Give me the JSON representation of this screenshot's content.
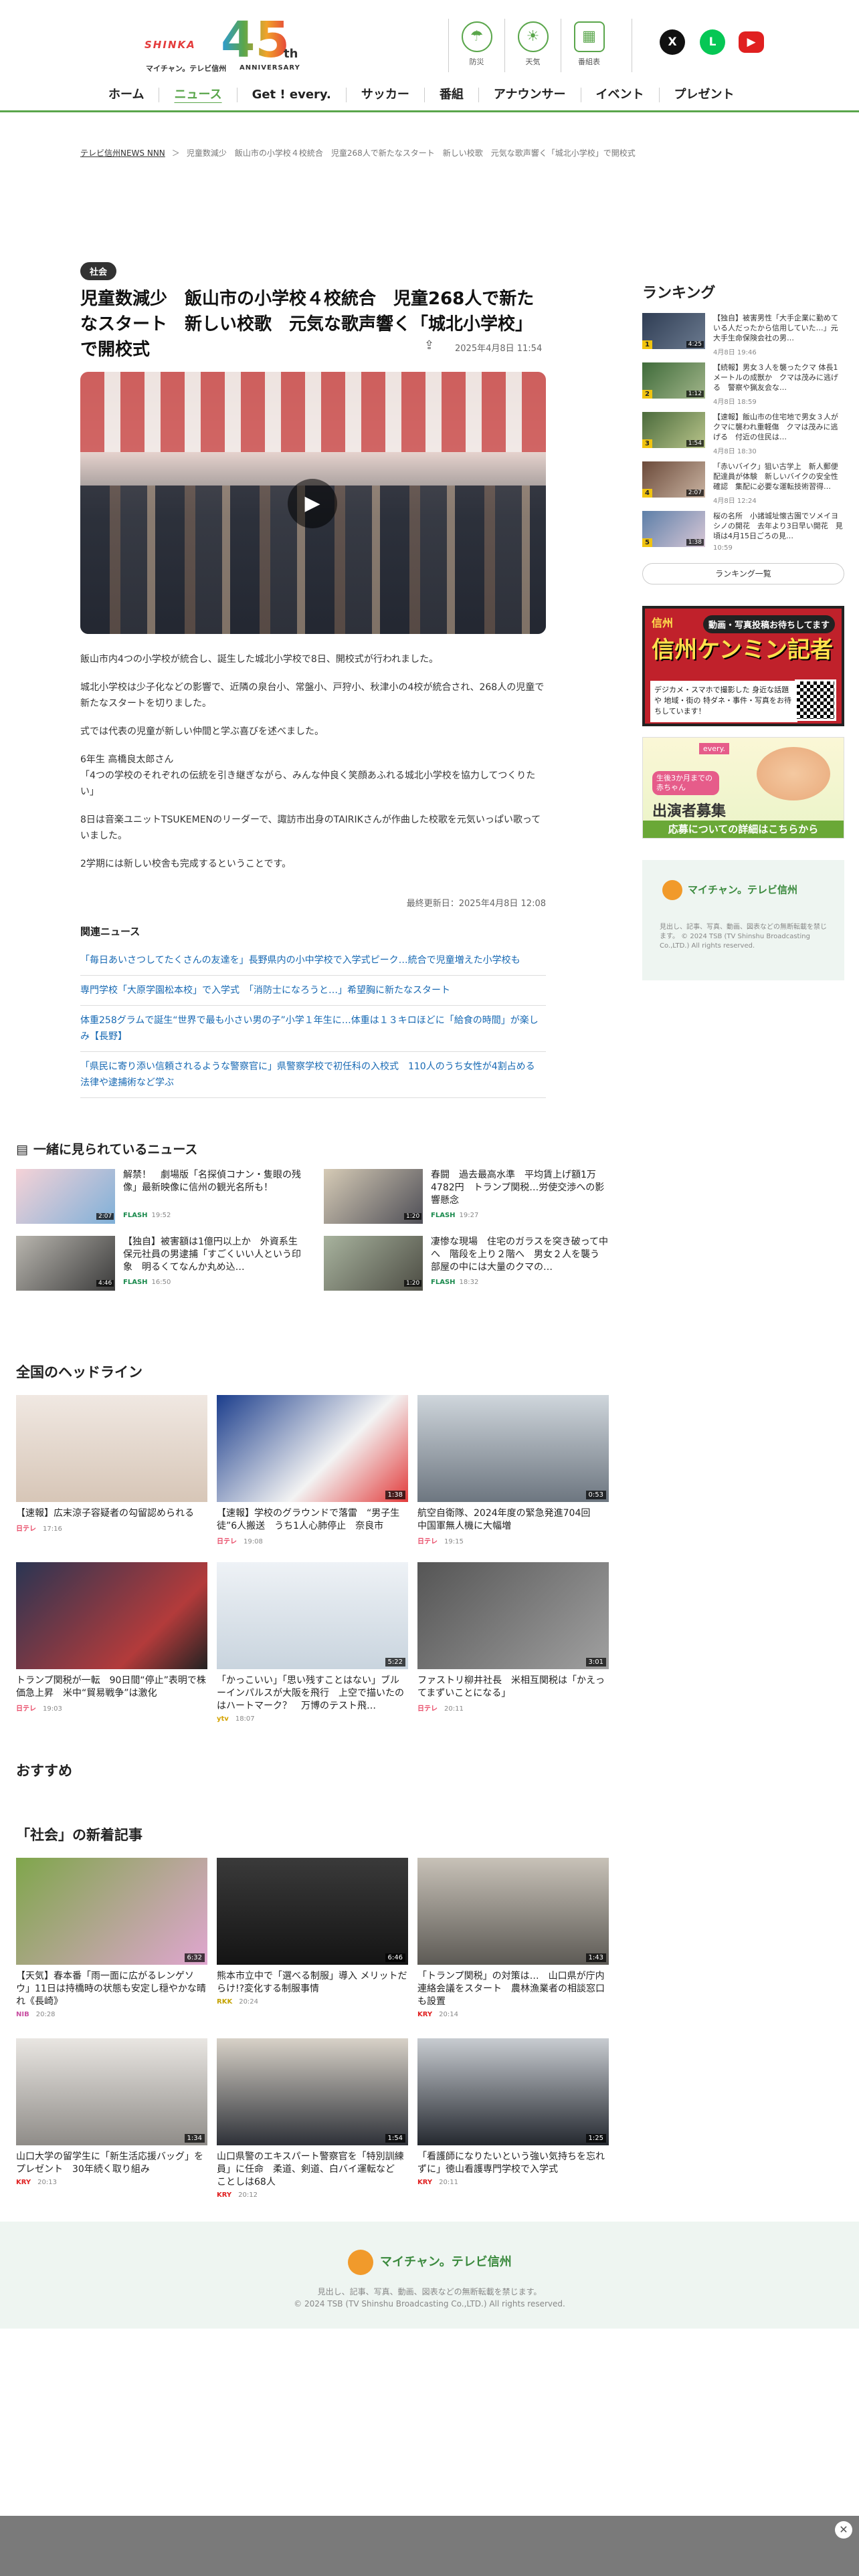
{
  "header": {
    "logo_shinka": "SHINKA",
    "logo_number": "45",
    "logo_th": "th",
    "logo_sub1": "マイチャン。テレビ信州",
    "logo_sub2": "ANNIVERSARY",
    "util": [
      {
        "label": "防災",
        "icon": "umbrella-icon"
      },
      {
        "label": "天気",
        "icon": "sun-icon"
      },
      {
        "label": "番組表",
        "icon": "grid-icon"
      }
    ],
    "sns": [
      {
        "label": "X",
        "color": "#111111"
      },
      {
        "label": "L",
        "color": "#06c755"
      },
      {
        "label": "▶",
        "color": "#e02020"
      }
    ],
    "nav": [
      "ホーム",
      "ニュース",
      "Get ! every.",
      "サッカー",
      "番組",
      "アナウンサー",
      "イベント",
      "プレゼント"
    ]
  },
  "breadcrumb": [
    "テレビ信州NEWS NNN",
    "＞",
    "児童数減少　飯山市の小学校４校統合　児童268人で新たなスタート　新しい校歌　元気な歌声響く「城北小学校」で開校式"
  ],
  "article": {
    "category": "社会",
    "title": "児童数減少　飯山市の小学校４校統合　児童268人で新たなスタート　新しい校歌　元気な歌声響く「城北小学校」で開校式",
    "share_icon": "share-icon",
    "date": "2025年4月8日 11:54",
    "paragraphs": [
      "飯山市内4つの小学校が統合し、誕生した城北小学校で8日、開校式が行われました。",
      "城北小学校は少子化などの影響で、近隣の泉台小、常盤小、戸狩小、秋津小の4校が統合され、268人の児童で新たなスタートを切りました。",
      "式では代表の児童が新しい仲間と学ぶ喜びを述べました。",
      "6年生 高橋良太郎さん\n「4つの学校のそれぞれの伝統を引き継ぎながら、みんな仲良く笑顔あふれる城北小学校を協力してつくりたい」",
      "8日は音楽ユニットTSUKEMENのリーダーで、諏訪市出身のTAIRIKさんが作曲した校歌を元気いっぱい歌っていました。",
      "2学期には新しい校舎も完成するということです。"
    ],
    "updated": "最終更新日：2025年4月8日 12:08",
    "related_heading": "関連ニュース",
    "related": [
      "「毎日あいさつしてたくさんの友達を」長野県内の小中学校で入学式ピーク…統合で児童増えた小学校も",
      "専門学校「大原学園松本校」で入学式　「消防士になろうと…」希望胸に新たなスタート",
      "体重258グラムで誕生“世界で最も小さい男の子”小学１年生に…体重は１３キロほどに「給食の時間」が楽しみ【長野】",
      "「県民に寄り添い信頼されるような警察官に」県警察学校で初任科の入校式　110人のうち女性が4割占める　法律や逮捕術など学ぶ"
    ]
  },
  "sidebar": {
    "ranking_heading": "ランキング",
    "ranking": [
      {
        "num": "1",
        "dur": "4:25",
        "text": "【独自】被害男性「大手企業に勤めている人だったから信用していた…」元大手生命保険会社の男…",
        "time": "4月8日 19:46"
      },
      {
        "num": "2",
        "dur": "1:12",
        "text": "【続報】男女３人を襲ったクマ 体長1メートルの成獣か　クマは茂みに逃げる　警察や猟友会な…",
        "time": "4月8日 18:59"
      },
      {
        "num": "3",
        "dur": "1:54",
        "text": "【速報】飯山市の住宅地で男女３人がクマに襲われ重軽傷　クマは茂みに逃げる　付近の住民は…",
        "time": "4月8日 18:30"
      },
      {
        "num": "4",
        "dur": "2:07",
        "text": "「赤いバイク」狙い古学上　新人郵便配達員が体験　新しいバイクの安全性確認　集配に必要な運転技術習得…",
        "time": "4月8日 12:24"
      },
      {
        "num": "5",
        "dur": "1:38",
        "text": "桜の名所　小諸城址懐古園でソメイヨシノの開花　去年より3日早い開花　見頃は4月15日ごろの見…",
        "time": "10:59"
      }
    ],
    "ranking_button": "ランキング一覧",
    "ad1": {
      "top": "動画・写真投稿お待ちしてます",
      "brand": "信州ケンミン記者",
      "badge": "信州",
      "desc": "デジカメ・スマホで撮影した 身近な話題や 地域・街の 特ダネ・事件・写真をお待ちしています！"
    },
    "ad2": {
      "tag": "every.",
      "tag2": "生後3か月までの赤ちゃん",
      "big": "出演者募集",
      "button": "応募についての詳細はこちらから"
    },
    "footer_card": {
      "name": "マイチャン。テレビ信州",
      "text": "見出し、記事、写真、動画、図表などの無断転載を禁じます。 © 2024 TSB (TV Shinshu Broadcasting Co.,LTD.) All rights reserved."
    }
  },
  "watched": {
    "heading": "一緒に見られているニュース",
    "items": [
      {
        "dur": "2:07",
        "text": "解禁！　劇場版「名探偵コナン・隻眼の残像」最新映像に信州の観光名所も！",
        "src": "FLASH",
        "time": "19:52"
      },
      {
        "dur": "1:20",
        "text": "春闘　過去最高水準　平均賃上げ額1万4782円　トランプ関税…労使交渉への影響懸念",
        "src": "FLASH",
        "time": "19:27"
      },
      {
        "dur": "4:46",
        "text": "【独自】被害額は1億円以上か　外資系生保元社員の男逮捕「すごくいい人という印象　明るくてなんか丸め込…",
        "src": "FLASH",
        "time": "16:50"
      },
      {
        "dur": "1:20",
        "text": "凄惨な現場　住宅のガラスを突き破って中へ　階段を上り２階へ　男女２人を襲う　部屋の中には大量のクマの…",
        "src": "FLASH",
        "time": "18:32"
      }
    ]
  },
  "national": {
    "heading": "全国のヘッドライン",
    "items": [
      {
        "text": "【速報】広末涼子容疑者の勾留認められる",
        "src": "日テレ",
        "time": "17:16",
        "dur": ""
      },
      {
        "text": "【速報】学校のグラウンドで落雷　“男子生徒”6人搬送　うち1人心肺停止　奈良市",
        "src": "日テレ",
        "time": "19:08",
        "dur": "1:38"
      },
      {
        "text": "航空自衛隊、2024年度の緊急発進704回　中国軍無人機に大幅増",
        "src": "日テレ",
        "time": "19:15",
        "dur": "0:53"
      },
      {
        "text": "トランプ関税が一転　90日間“停止”表明で株価急上昇　米中“貿易戦争”は激化",
        "src": "日テレ",
        "time": "19:03",
        "dur": ""
      },
      {
        "text": "「かっこいい」「思い残すことはない」ブルーインパルスが大阪を飛行　上空で描いたのはハートマーク？　万博のテスト飛…",
        "src": "ytv",
        "time": "18:07",
        "dur": "5:22"
      },
      {
        "text": "ファストリ柳井社長　米相互関税は「かえってまずいことになる」",
        "src": "日テレ",
        "time": "20:11",
        "dur": "3:01"
      }
    ]
  },
  "recommend": {
    "heading": "おすすめ"
  },
  "society": {
    "heading": "「社会」の新着記事",
    "items": [
      {
        "text": "【天気】春本番「雨一面に広がるレンゲソウ」11日は持橋時の状態も安定し穏やかな晴れ《長崎》",
        "src": "NIB",
        "time": "20:28",
        "dur": "6:32"
      },
      {
        "text": "熊本市立中で「選べる制服」導入 メリットだらけ!?変化する制服事情",
        "src": "RKK",
        "time": "20:24",
        "dur": "6:46"
      },
      {
        "text": "「トランプ関税」の対策は…　山口県が庁内連絡会議をスタート　農林漁業者の相談窓口も設置",
        "src": "KRY",
        "time": "20:14",
        "dur": "1:43"
      },
      {
        "text": "山口大学の留学生に「新生活応援バッグ」をプレゼント　30年続く取り組み",
        "src": "KRY",
        "time": "20:13",
        "dur": "1:34"
      },
      {
        "text": "山口県警のエキスパート警察官を「特別訓練員」に任命　柔道、剣道、白バイ運転など　ことしは68人",
        "src": "KRY",
        "time": "20:12",
        "dur": "1:54"
      },
      {
        "text": "「看護師になりたいという強い気持ちを忘れずに」徳山看護専門学校で入学式",
        "src": "KRY",
        "time": "20:11",
        "dur": "1:25"
      }
    ]
  },
  "footer": {
    "name": "マイチャン。テレビ信州",
    "line1": "見出し、記事、写真、動画、図表などの無断転載を禁じます。",
    "line2": "© 2024 TSB (TV Shinshu Broadcasting Co.,LTD.) All rights reserved."
  },
  "bottom_bar": {
    "close": "✕"
  },
  "colors": {
    "brand_green": "#5aa64b",
    "link_blue": "#1769b3",
    "rank_badge": "#f1c40f"
  }
}
